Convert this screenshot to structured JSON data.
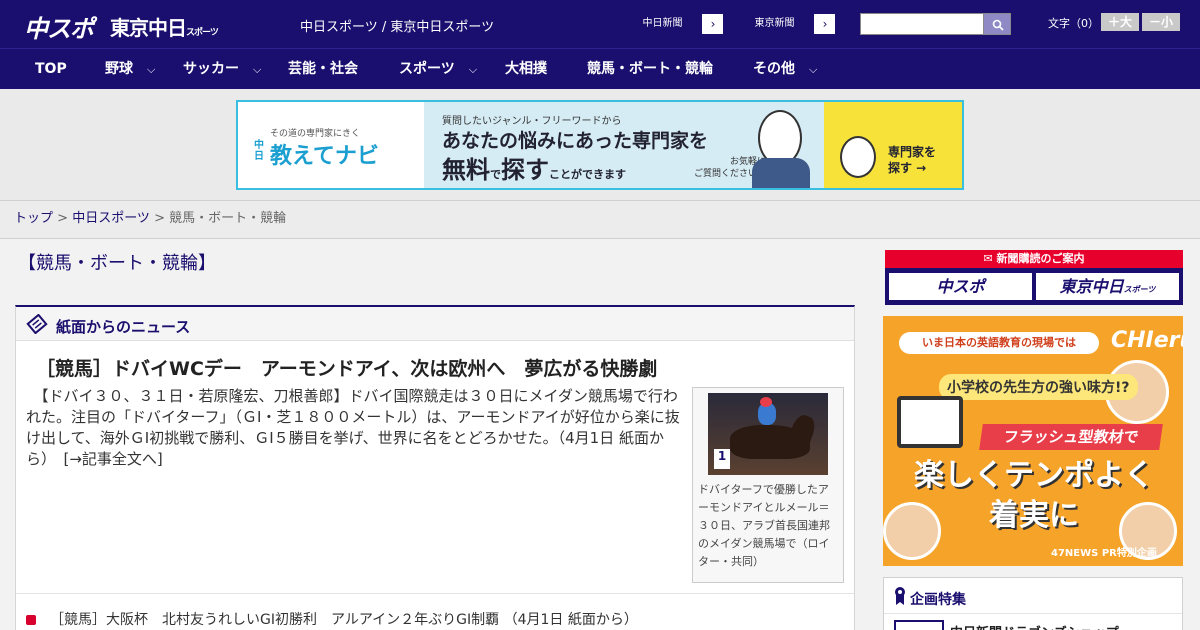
{
  "header": {
    "logo_chuspo": "中スポ",
    "logo_tokyo": "東京中日",
    "logo_tokyo_sub": "スポーツ",
    "site_links": "中日スポーツ / 東京中日スポーツ",
    "paper_buttons": [
      {
        "label": "中日新聞",
        "arrow": "›"
      },
      {
        "label": "東京新聞",
        "arrow": "›"
      }
    ],
    "search": {
      "value": "",
      "placeholder": ""
    },
    "fontsize": {
      "label": "文字（0）",
      "larger": "＋大",
      "smaller": "－小"
    }
  },
  "nav": {
    "items": [
      {
        "label": "TOP"
      },
      {
        "label": "野球",
        "chev": "⌵"
      },
      {
        "label": "サッカー",
        "chev": "⌵"
      },
      {
        "label": "芸能・社会"
      },
      {
        "label": "スポーツ",
        "chev": "⌵"
      },
      {
        "label": "大相撲"
      },
      {
        "label": "競馬・ボート・競輪"
      },
      {
        "label": "その他",
        "chev": "⌵"
      }
    ]
  },
  "ad_banner": {
    "brand_small": "その道の専門家にきく",
    "brand_vertical": "中日",
    "brand_big": "教えてナビ",
    "line1": "質問したいジャンル・フリーワードから",
    "line2": "あなたの悩みにあった専門家を",
    "line3_a": "無料",
    "line3_b": "で",
    "line3_c": "探す",
    "line3_d": "ことができます",
    "line4_a": "お気軽に",
    "line4_b": "ご質問ください！",
    "cta_a": "専門家を",
    "cta_b": "探す →"
  },
  "breadcrumb": {
    "home": "トップ",
    "sep1": " > ",
    "section": "中日スポーツ",
    "sep2": " > ",
    "current": "競馬・ボート・競輪"
  },
  "page": {
    "heading": "【競馬・ボート・競輪】"
  },
  "news": {
    "section_title": "紙面からのニュース",
    "headline": "［競馬］ドバイWCデー　アーモンドアイ、次は欧州へ　夢広がる快勝劇",
    "body": "　【ドバイ３０、３１日・若原隆宏、刀根善郎】ドバイ国際競走は３０日にメイダン競馬場で行われた。注目の「ドバイターフ」（ＧⅠ・芝１８００メートル）は、アーモンドアイが好位から楽に抜け出して、海外ＧⅠ初挑戦で勝利、ＧⅠ５勝目を挙げ、世界に名をとどろかせた。（4月1日 紙面から）　",
    "more_link": "[→記事全文へ]",
    "caption": "ドバイターフで優勝したアーモンドアイとルメール＝３０日、アラブ首長国連邦のメイダン競馬場で（ロイター・共同）",
    "list_item": "［競馬］大阪杯　北村友うれしいGI初勝利　アルアイン２年ぶりGI制覇 （4月1日 紙面から）"
  },
  "sidebar": {
    "subscription_head": "新聞購読のご案内",
    "sub_chuspo": "中スポ",
    "sub_tokyo": "東京中日",
    "sub_tokyo_small": "スポーツ",
    "ad": {
      "topline": "いま日本の英語教育の現場では",
      "brand": "CHIeru",
      "question": "小学校の先生方の強い味方!?",
      "tag": "フラッシュ型教材で",
      "big1": "楽しくテンポよく",
      "big2": "着実に",
      "footer": "47NEWS PR特別企画"
    },
    "feature_title": "企画特集",
    "feature_item": "中日新聞ドラゴンズショップ"
  },
  "colors": {
    "brand_navy": "#1a0f6e",
    "accent_red": "#e8002d",
    "banner_border": "#39c0e0"
  }
}
